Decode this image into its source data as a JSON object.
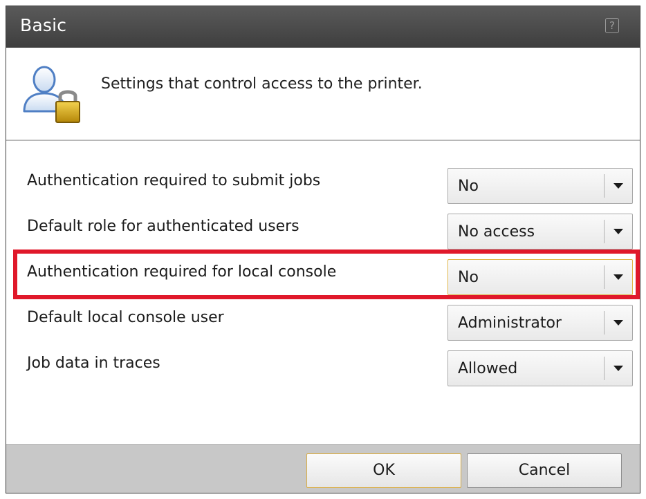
{
  "window": {
    "title": "Basic",
    "help_label": "?"
  },
  "header": {
    "icon": "user-lock-icon",
    "description": "Settings that control access to the printer."
  },
  "settings": [
    {
      "label": "Authentication required to submit jobs",
      "value": "No"
    },
    {
      "label": "Default role for authenticated users",
      "value": "No access"
    },
    {
      "label": "Authentication required for local console",
      "value": "No",
      "highlighted": true
    },
    {
      "label": "Default local console user",
      "value": "Administrator"
    },
    {
      "label": "Job data in traces",
      "value": "Allowed"
    }
  ],
  "footer": {
    "ok_label": "OK",
    "cancel_label": "Cancel"
  },
  "colors": {
    "titlebar": "#4a4a4a",
    "highlight": "#e0182a",
    "focus_border": "#e0b548",
    "footer": "#c8c8c8"
  }
}
